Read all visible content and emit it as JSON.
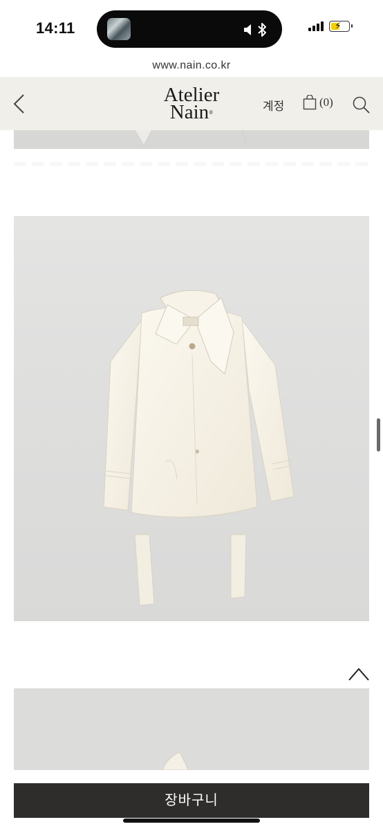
{
  "status_bar": {
    "time": "14:11",
    "icons": [
      "music-artwork-icon",
      "speaker-icon",
      "bluetooth-icon",
      "signal-icon",
      "battery-charging-icon"
    ]
  },
  "browser": {
    "url": "www.nain.co.kr"
  },
  "header": {
    "logo_line1": "Atelier",
    "logo_line2": "Nain",
    "account_label": "계정",
    "cart_count": "(0)",
    "back_icon": "chevron-left-icon",
    "search_icon": "search-icon",
    "bag_icon": "shopping-bag-icon"
  },
  "product": {
    "image_subject": "ivory wool short coat with belt"
  },
  "actions": {
    "scroll_top_icon": "chevron-up-icon",
    "add_to_cart_label": "장바구니"
  },
  "colors": {
    "header_bg": "#f1efea",
    "cart_button_bg": "#2f2d2c",
    "photo_bg": "#e0e0df"
  }
}
